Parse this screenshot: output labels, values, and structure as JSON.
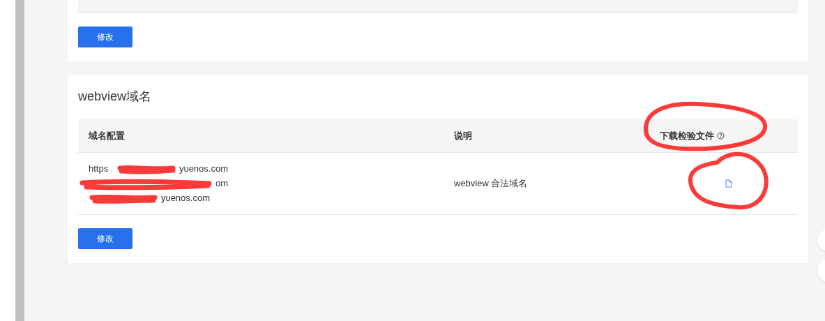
{
  "top_card": {
    "button": "修改"
  },
  "webview_card": {
    "title": "webview域名",
    "columns": [
      "域名配置",
      "说明",
      "下载检验文件"
    ],
    "rows": [
      {
        "domains": [
          {
            "start": "https",
            "end": "yuenos.com"
          },
          {
            "end": "om"
          },
          {
            "end": "yuenos.com"
          }
        ],
        "description": "webview 合法域名"
      }
    ],
    "button": "修改"
  }
}
